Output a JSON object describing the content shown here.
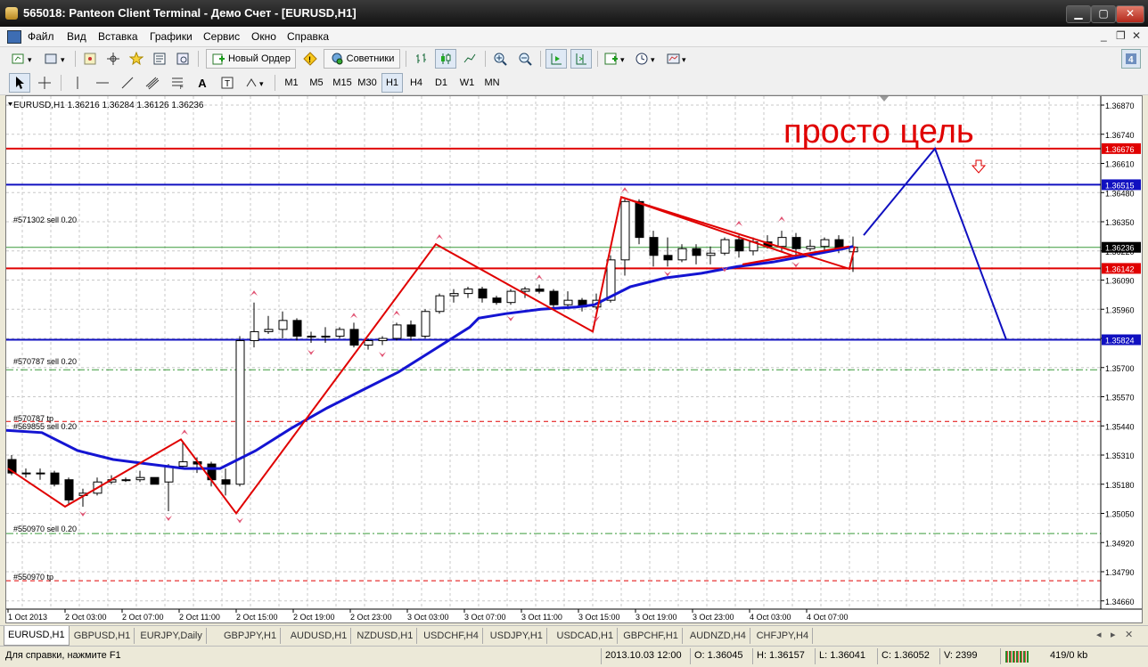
{
  "window": {
    "title": "565018: Panteon Client Terminal - Демо Счет - [EURUSD,H1]",
    "min": "▁",
    "max": "▢",
    "close": "✕"
  },
  "menu": [
    "Файл",
    "Вид",
    "Вставка",
    "Графики",
    "Сервис",
    "Окно",
    "Справка"
  ],
  "mdi_controls": {
    "min": "_",
    "restore": "❐",
    "close": "✕"
  },
  "toolbar": {
    "new_order": "Новый Ордер",
    "advisors": "Советники"
  },
  "timeframes": [
    "M1",
    "M5",
    "M15",
    "M30",
    "H1",
    "H4",
    "D1",
    "W1",
    "MN"
  ],
  "active_timeframe": "H1",
  "chart": {
    "header": "EURUSD,H1  1.36216  1.36284  1.36126  1.36236",
    "annotation": "просто цель",
    "price_axis": [
      "1.36870",
      "1.36740",
      "1.36610",
      "1.36480",
      "1.36350",
      "1.36220",
      "1.36090",
      "1.35960",
      "1.35830",
      "1.35700",
      "1.35570",
      "1.35440",
      "1.35310",
      "1.35180",
      "1.35050",
      "1.34920",
      "1.34790",
      "1.34660"
    ],
    "price_markers": [
      {
        "label": "1.36676",
        "color": "#e00000"
      },
      {
        "label": "1.36515",
        "color": "#1010c0"
      },
      {
        "label": "1.36236",
        "color": "#000000"
      },
      {
        "label": "1.36142",
        "color": "#e00000"
      },
      {
        "label": "1.35824",
        "color": "#1010c0"
      }
    ],
    "time_axis": [
      "1 Oct 2013",
      "2 Oct 03:00",
      "2 Oct 07:00",
      "2 Oct 11:00",
      "2 Oct 15:00",
      "2 Oct 19:00",
      "2 Oct 23:00",
      "3 Oct 03:00",
      "3 Oct 07:00",
      "3 Oct 11:00",
      "3 Oct 15:00",
      "3 Oct 19:00",
      "3 Oct 23:00",
      "4 Oct 03:00",
      "4 Oct 07:00"
    ],
    "order_labels": [
      "#571302 sell 0.20",
      "#570787 sell 0.20",
      "#570787 tp",
      "#569855 sell 0.20",
      "#550970 sell 0.20",
      "#550970 tp"
    ],
    "colors": {
      "red_line": "#e00000",
      "blue_line": "#1010c0",
      "ma": "#1414d2",
      "zigzag": "#e00000"
    }
  },
  "tabs": [
    "EURUSD,H1",
    "GBPUSD,H1",
    "EURJPY,Daily",
    "GBPJPY,H1",
    "AUDUSD,H1",
    "NZDUSD,H1",
    "USDCHF,H4",
    "USDJPY,H1",
    "USDCAD,H1",
    "GBPCHF,H1",
    "AUDNZD,H4",
    "CHFJPY,H4"
  ],
  "active_tab": "EURUSD,H1",
  "status": {
    "help": "Для справки, нажмите F1",
    "datetime": "2013.10.03 12:00",
    "open": "O: 1.36045",
    "high": "H: 1.36157",
    "low": "L: 1.36041",
    "close": "C: 1.36052",
    "volume": "V: 2399",
    "traffic": "419/0 kb"
  }
}
